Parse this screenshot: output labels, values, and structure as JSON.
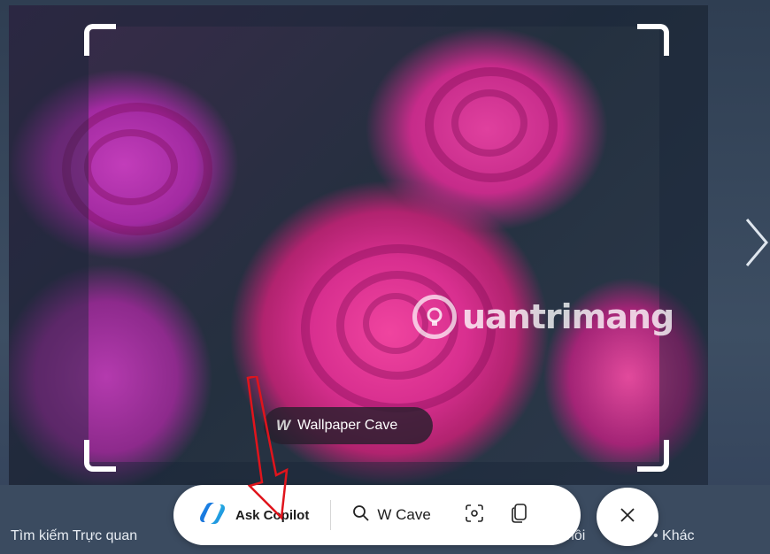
{
  "viewer": {
    "source_label": "Wallpaper Cave",
    "source_logo": "W",
    "watermark_text": "uantrimang"
  },
  "toolbar": {
    "copilot_label": "Ask Copilot",
    "search_label": "W Cave",
    "icons": [
      "copilot-icon",
      "search-icon",
      "visual-search-icon",
      "copy-icon"
    ]
  },
  "bottom": {
    "left_link": "Tìm kiếm Trực quan",
    "mid_fragment": "hôi",
    "more_label": "• Khác"
  },
  "colors": {
    "toolbar_bg": "#ffffff",
    "page_bg": "#3b4b60",
    "annotation_arrow": "#e0141c"
  }
}
